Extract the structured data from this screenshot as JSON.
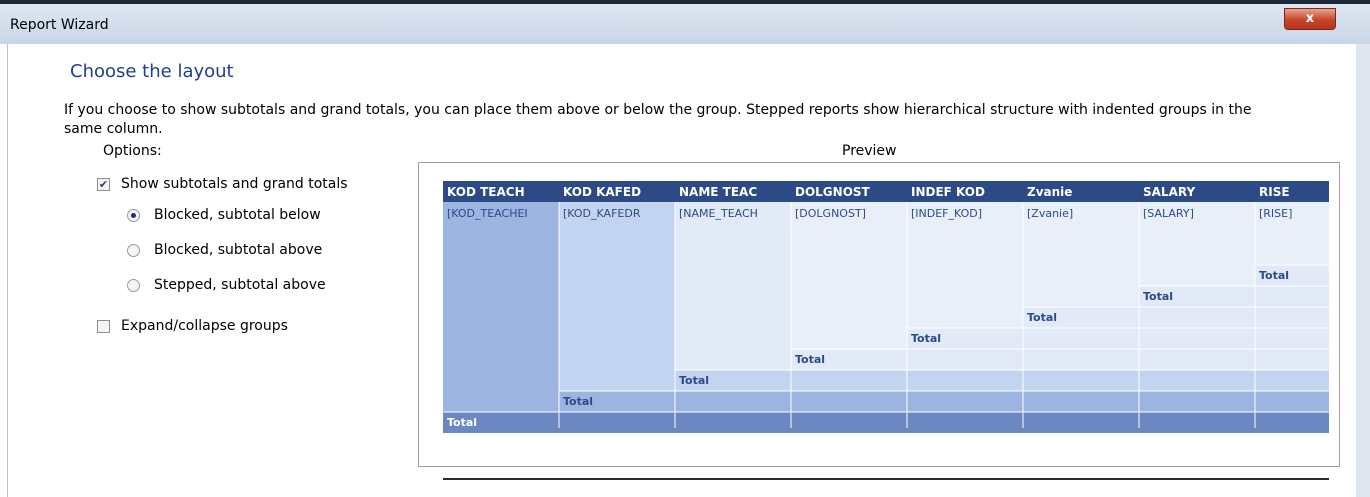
{
  "window": {
    "title": "Report Wizard",
    "close_label": "x"
  },
  "page": {
    "heading": "Choose the layout",
    "description": "If you choose to show subtotals and grand totals, you can place them above or below the group. Stepped reports show hierarchical structure with indented groups in the same column."
  },
  "options": {
    "label": "Options:",
    "show_totals": {
      "label": "Show subtotals and grand totals",
      "checked": true
    },
    "radios": [
      {
        "label": "Blocked, subtotal below",
        "selected": true
      },
      {
        "label": "Blocked, subtotal above",
        "selected": false
      },
      {
        "label": "Stepped, subtotal above",
        "selected": false
      }
    ],
    "expand_collapse": {
      "label": "Expand/collapse groups",
      "checked": false
    }
  },
  "preview": {
    "label": "Preview",
    "columns": [
      "KOD TEACH",
      "KOD KAFED",
      "NAME TEAC",
      "DOLGNOST",
      "INDEF KOD",
      "Zvanie",
      "SALARY",
      "RISE"
    ],
    "fields": [
      "[KOD_TEACHEI",
      "[KOD_KAFEDR",
      "[NAME_TEACH",
      "[DOLGNOST]",
      "[INDEF_KOD]",
      "[Zvanie]",
      "[SALARY]",
      "[RISE]"
    ],
    "total_label": "Total",
    "colors": {
      "header": "#2b4a86",
      "grand_total_row": "#6b88c3",
      "col1": "#9cb4e0",
      "col2": "#c3d4f1",
      "col3": "#e2eaf8",
      "col_rest": "#e9eff9",
      "text": "#2a4a8a"
    }
  }
}
